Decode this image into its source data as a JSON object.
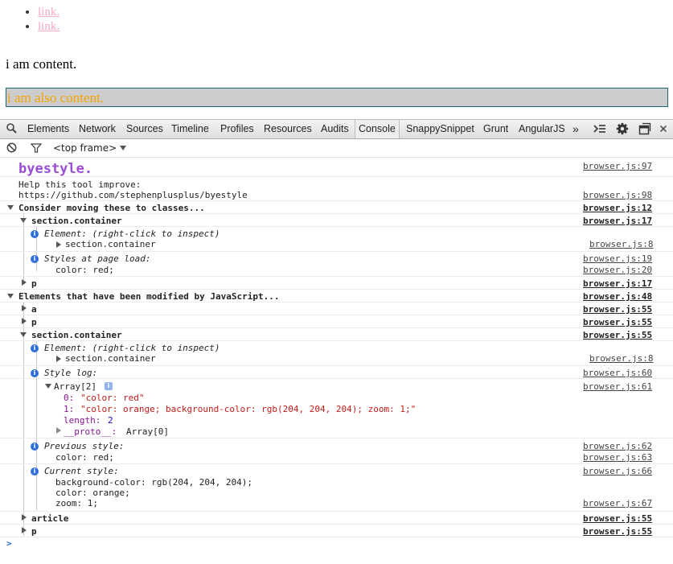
{
  "page": {
    "links": [
      "link.",
      "link."
    ],
    "content1": "i am content.",
    "content2": "i am also content."
  },
  "devtools": {
    "tabs": [
      "Elements",
      "Network",
      "Sources",
      "Timeline",
      "Profiles",
      "Resources",
      "Audits",
      "Console",
      "SnappySnippet",
      "Grunt",
      "AngularJS"
    ],
    "active_tab": "Console",
    "more_tabs": "»",
    "frame_selector": "<top frame>"
  },
  "console": {
    "title": "byestyle.",
    "help_line1": "Help this tool improve:",
    "help_line2": "https://github.com/stephenplusplus/byestyle",
    "group1": "Consider moving these to classes...",
    "section_container": "section.container",
    "element_label": "Element: (right-click to inspect)",
    "element_value": "section.container",
    "styles_at_load": "Styles at page load:",
    "color_red": "color: red;",
    "p": "p",
    "a": "a",
    "article": "article",
    "group2": "Elements that have been modified by JavaScript...",
    "style_log": "Style log:",
    "array_label": "Array[2]",
    "arr0_key": "0:",
    "arr0_val": "\"color: red\"",
    "arr1_key": "1:",
    "arr1_val": "\"color: orange; background-color: rgb(204, 204, 204); zoom: 1;\"",
    "length_key": "length:",
    "length_val": "2",
    "proto_key": "__proto__:",
    "proto_val": "Array[0]",
    "previous_style": "Previous style:",
    "current_style": "Current style:",
    "cur1": "background-color: rgb(204, 204, 204);",
    "cur2": "color: orange;",
    "cur3": "zoom: 1;",
    "prompt": ">",
    "sources": {
      "s97": "browser.js:97",
      "s98": "browser.js:98",
      "s12": "browser.js:12",
      "s17": "browser.js:17",
      "s8": "browser.js:8",
      "s19": "browser.js:19",
      "s20": "browser.js:20",
      "s48": "browser.js:48",
      "s55": "browser.js:55",
      "s60": "browser.js:60",
      "s61": "browser.js:61",
      "s62": "browser.js:62",
      "s63": "browser.js:63",
      "s66": "browser.js:66",
      "s67": "browser.js:67"
    }
  },
  "colors": {
    "link": "#f6a9c3",
    "content2": "#f5a300",
    "byestyle": "#9a4fd3",
    "info": "#2f6fd7"
  }
}
